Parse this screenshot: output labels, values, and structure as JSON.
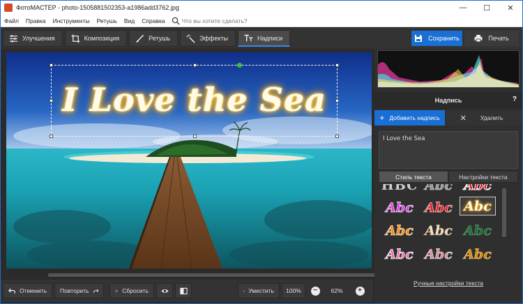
{
  "window": {
    "title": "ФотоМАСТЕР - photo-1505881502353-a1986add3762.jpg",
    "minimize_glyph": "—",
    "maximize_glyph": "☐",
    "close_glyph": "✕"
  },
  "menu": {
    "items": [
      "Файл",
      "Правка",
      "Инструменты",
      "Ретушь",
      "Вид",
      "Справка"
    ],
    "search_placeholder": "Что вы хотите сделать?"
  },
  "toolbar": {
    "tabs": [
      {
        "label": "Улучшения",
        "icon": "sliders-icon"
      },
      {
        "label": "Композиция",
        "icon": "crop-icon"
      },
      {
        "label": "Ретушь",
        "icon": "brush-icon"
      },
      {
        "label": "Эффекты",
        "icon": "magic-wand-icon"
      },
      {
        "label": "Надписи",
        "icon": "text-icon"
      }
    ],
    "active_tab": "Надписи",
    "save_label": "Сохранить",
    "print_label": "Печать"
  },
  "canvas": {
    "caption_text": "I Love the Sea"
  },
  "bottom": {
    "undo_label": "Отменить",
    "redo_label": "Повторить",
    "reset_label": "Сбросить",
    "fit_label": "Уместить",
    "zoom_100": "100%",
    "minus_glyph": "−",
    "plus_glyph": "+",
    "zoom_value": "62%"
  },
  "panel": {
    "header": "Надпись",
    "help": "?",
    "add_glyph": "+",
    "add_label": "Добавить надпись",
    "delete_glyph": "✕",
    "delete_label": "Удалить",
    "text_value": "I Love the Sea",
    "tabs": [
      "Стиль текста",
      "Настройки текста"
    ],
    "active_tab": "Стиль текста",
    "style_sample": "Abc",
    "style_sample_top": "HBC",
    "manual_link": "Ручные настройки текста"
  },
  "colors": {
    "accent": "#1a6fd4",
    "panel_bg": "#2f2f2f",
    "toolbar_bg": "#333333",
    "glow": "#ffb020"
  }
}
